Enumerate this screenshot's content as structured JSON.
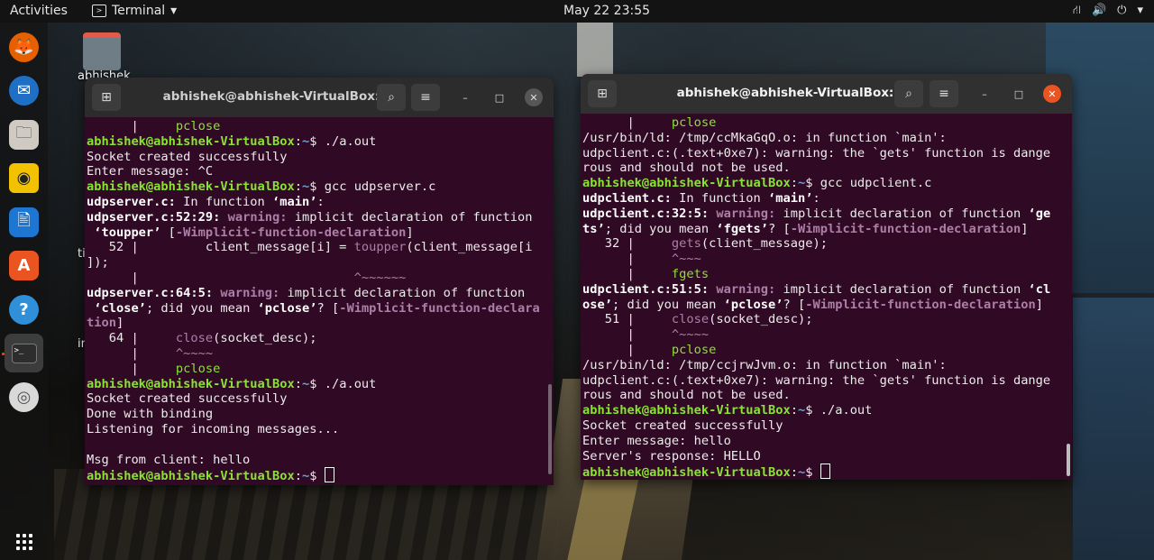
{
  "topbar": {
    "activities": "Activities",
    "app_name": "Terminal",
    "app_arrow": "▾",
    "clock": "May 22  23:55",
    "tray": {
      "network": "⛙",
      "volume": "🔊",
      "power": "⏻",
      "arrow": "▾"
    }
  },
  "dock": {
    "items": [
      {
        "name": "firefox-icon",
        "glyph": "🦊"
      },
      {
        "name": "thunderbird-icon",
        "glyph": "✉"
      },
      {
        "name": "files-icon",
        "glyph": "🗀"
      },
      {
        "name": "rhythmbox-icon",
        "glyph": "◉"
      },
      {
        "name": "writer-icon",
        "glyph": "🖹"
      },
      {
        "name": "software-icon",
        "glyph": "A"
      },
      {
        "name": "help-icon",
        "glyph": "?"
      },
      {
        "name": "terminal-icon",
        "glyph": ">_"
      },
      {
        "name": "dvd-icon",
        "glyph": "◎"
      }
    ]
  },
  "desktop": {
    "home_label": "abhishek",
    "frag1": "ti",
    "frag2": "in"
  },
  "left_window": {
    "title": "abhishek@abhishek-VirtualBox: ~",
    "lines": [
      [
        [
          "      |     ",
          ""
        ],
        [
          "pclose",
          "grn"
        ]
      ],
      [
        [
          "abhishek@abhishek-VirtualBox",
          "p-u"
        ],
        [
          ":",
          ""
        ],
        [
          "~",
          "p-d"
        ],
        [
          "$ ./a.out",
          ""
        ]
      ],
      [
        [
          "Socket created successfully",
          ""
        ]
      ],
      [
        [
          "Enter message: ^C",
          ""
        ]
      ],
      [
        [
          "abhishek@abhishek-VirtualBox",
          "p-u"
        ],
        [
          ":",
          ""
        ],
        [
          "~",
          "p-d"
        ],
        [
          "$ gcc udpserver.c",
          ""
        ]
      ],
      [
        [
          "udpserver.c:",
          "bold"
        ],
        [
          " In function ",
          ""
        ],
        [
          "‘main’",
          "bold"
        ],
        [
          ":",
          ""
        ]
      ],
      [
        [
          "udpserver.c:52:29:",
          "bold"
        ],
        [
          " ",
          ""
        ],
        [
          "warning:",
          "warn"
        ],
        [
          " implicit declaration of function",
          ""
        ]
      ],
      [
        [
          " ‘toupper’",
          "bold"
        ],
        [
          " [",
          ""
        ],
        [
          "-Wimplicit-function-declaration",
          "warn"
        ],
        [
          "]",
          ""
        ]
      ],
      [
        [
          "   52 |         client_message[i] = ",
          ""
        ],
        [
          "toupper",
          "purp"
        ],
        [
          "(client_message[i",
          ""
        ]
      ],
      [
        [
          "]);",
          ""
        ]
      ],
      [
        [
          "      |                             ",
          ""
        ],
        [
          "^~~~~~~",
          "purp"
        ]
      ],
      [
        [
          "udpserver.c:64:5:",
          "bold"
        ],
        [
          " ",
          ""
        ],
        [
          "warning:",
          "warn"
        ],
        [
          " implicit declaration of function",
          ""
        ]
      ],
      [
        [
          " ‘close’",
          "bold"
        ],
        [
          "; did you mean ",
          ""
        ],
        [
          "‘pclose’",
          "bold"
        ],
        [
          "? [",
          ""
        ],
        [
          "-Wimplicit-function-declara",
          "warn"
        ]
      ],
      [
        [
          "tion",
          "warn"
        ],
        [
          "]",
          ""
        ]
      ],
      [
        [
          "   64 |     ",
          ""
        ],
        [
          "close",
          "purp"
        ],
        [
          "(socket_desc);",
          ""
        ]
      ],
      [
        [
          "      |     ",
          ""
        ],
        [
          "^~~~~",
          "purp"
        ]
      ],
      [
        [
          "      |     ",
          ""
        ],
        [
          "pclose",
          "grn"
        ]
      ],
      [
        [
          "abhishek@abhishek-VirtualBox",
          "p-u"
        ],
        [
          ":",
          ""
        ],
        [
          "~",
          "p-d"
        ],
        [
          "$ ./a.out",
          ""
        ]
      ],
      [
        [
          "Socket created successfully",
          ""
        ]
      ],
      [
        [
          "Done with binding",
          ""
        ]
      ],
      [
        [
          "Listening for incoming messages...",
          ""
        ]
      ],
      [
        [
          "",
          ""
        ]
      ],
      [
        [
          "Msg from client: hello",
          ""
        ]
      ],
      [
        [
          "abhishek@abhishek-VirtualBox",
          "p-u"
        ],
        [
          ":",
          ""
        ],
        [
          "~",
          "p-d"
        ],
        [
          "$ ",
          ""
        ]
      ]
    ]
  },
  "right_window": {
    "title": "abhishek@abhishek-VirtualBox: ~",
    "lines": [
      [
        [
          "      |     ",
          ""
        ],
        [
          "pclose",
          "grn"
        ]
      ],
      [
        [
          "/usr/bin/ld: /tmp/ccMkaGqO.o: in function `main':",
          ""
        ]
      ],
      [
        [
          "udpclient.c:(.text+0xe7): warning: the `gets' function is dange",
          ""
        ]
      ],
      [
        [
          "rous and should not be used.",
          ""
        ]
      ],
      [
        [
          "abhishek@abhishek-VirtualBox",
          "p-u"
        ],
        [
          ":",
          ""
        ],
        [
          "~",
          "p-d"
        ],
        [
          "$ gcc udpclient.c",
          ""
        ]
      ],
      [
        [
          "udpclient.c:",
          "bold"
        ],
        [
          " In function ",
          ""
        ],
        [
          "‘main’",
          "bold"
        ],
        [
          ":",
          ""
        ]
      ],
      [
        [
          "udpclient.c:32:5:",
          "bold"
        ],
        [
          " ",
          ""
        ],
        [
          "warning:",
          "warn"
        ],
        [
          " implicit declaration of function ",
          ""
        ],
        [
          "‘ge",
          "bold"
        ]
      ],
      [
        [
          "ts’",
          "bold"
        ],
        [
          "; did you mean ",
          ""
        ],
        [
          "‘fgets’",
          "bold"
        ],
        [
          "? [",
          ""
        ],
        [
          "-Wimplicit-function-declaration",
          "warn"
        ],
        [
          "]",
          ""
        ]
      ],
      [
        [
          "   32 |     ",
          ""
        ],
        [
          "gets",
          "purp"
        ],
        [
          "(client_message);",
          ""
        ]
      ],
      [
        [
          "      |     ",
          ""
        ],
        [
          "^~~~",
          "purp"
        ]
      ],
      [
        [
          "      |     ",
          ""
        ],
        [
          "fgets",
          "grn"
        ]
      ],
      [
        [
          "udpclient.c:51:5:",
          "bold"
        ],
        [
          " ",
          ""
        ],
        [
          "warning:",
          "warn"
        ],
        [
          " implicit declaration of function ",
          ""
        ],
        [
          "‘cl",
          "bold"
        ]
      ],
      [
        [
          "ose’",
          "bold"
        ],
        [
          "; did you mean ",
          ""
        ],
        [
          "‘pclose’",
          "bold"
        ],
        [
          "? [",
          ""
        ],
        [
          "-Wimplicit-function-declaration",
          "warn"
        ],
        [
          "]",
          ""
        ]
      ],
      [
        [
          "   51 |     ",
          ""
        ],
        [
          "close",
          "purp"
        ],
        [
          "(socket_desc);",
          ""
        ]
      ],
      [
        [
          "      |     ",
          ""
        ],
        [
          "^~~~~",
          "purp"
        ]
      ],
      [
        [
          "      |     ",
          ""
        ],
        [
          "pclose",
          "grn"
        ]
      ],
      [
        [
          "/usr/bin/ld: /tmp/ccjrwJvm.o: in function `main':",
          ""
        ]
      ],
      [
        [
          "udpclient.c:(.text+0xe7): warning: the `gets' function is dange",
          ""
        ]
      ],
      [
        [
          "rous and should not be used.",
          ""
        ]
      ],
      [
        [
          "abhishek@abhishek-VirtualBox",
          "p-u"
        ],
        [
          ":",
          ""
        ],
        [
          "~",
          "p-d"
        ],
        [
          "$ ./a.out",
          ""
        ]
      ],
      [
        [
          "Socket created successfully",
          ""
        ]
      ],
      [
        [
          "Enter message: hello",
          ""
        ]
      ],
      [
        [
          "Server's response: HELLO",
          ""
        ]
      ],
      [
        [
          "abhishek@abhishek-VirtualBox",
          "p-u"
        ],
        [
          ":",
          ""
        ],
        [
          "~",
          "p-d"
        ],
        [
          "$ ",
          ""
        ]
      ]
    ]
  },
  "buttons": {
    "new_tab": "⊞",
    "search": "⌕",
    "menu": "≡",
    "minimize": "–",
    "maximize": "□",
    "close": "✕"
  }
}
